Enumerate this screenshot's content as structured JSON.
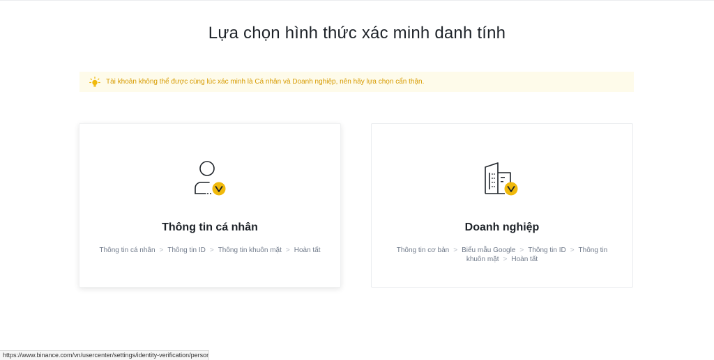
{
  "page": {
    "title": "Lựa chọn hình thức xác minh danh tính"
  },
  "notice": {
    "icon": "lightbulb-icon",
    "text": "Tài khoản không thể được cùng lúc xác minh là Cá nhân và Doanh nghiệp, nên hãy lựa chọn cẩn thận.",
    "color": "#d79b00",
    "background": "#fefbea"
  },
  "options": {
    "personal": {
      "icon": "user-check-icon",
      "title": "Thông tin cá nhân",
      "steps": [
        "Thông tin cá nhân",
        "Thông tin ID",
        "Thông tin khuôn mặt",
        "Hoàn tất"
      ]
    },
    "business": {
      "icon": "building-check-icon",
      "title": "Doanh nghiệp",
      "steps": [
        "Thông tin cơ bản",
        "Biểu mẫu Google",
        "Thông tin ID",
        "Thông tin khuôn mặt",
        "Hoàn tất"
      ]
    }
  },
  "status_bar": {
    "url": "https://www.binance.com/vn/usercenter/settings/identity-verification/personal/1"
  },
  "colors": {
    "accent": "#f0b90b",
    "text_primary": "#1e2329",
    "text_secondary": "#707a8a"
  }
}
